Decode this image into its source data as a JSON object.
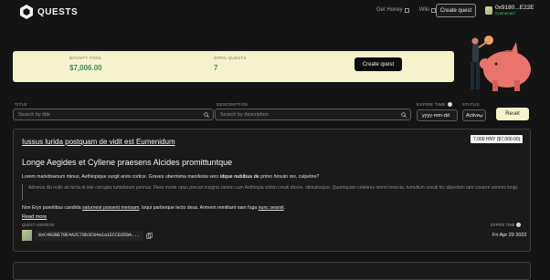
{
  "header": {
    "logo_text": "QUESTS",
    "links": [
      {
        "label": "Get Honey"
      },
      {
        "label": "Wiki"
      }
    ],
    "create_quest_label": "Create quest",
    "wallet": {
      "address": "0x9180...E22E",
      "status": "Connected"
    }
  },
  "hero": {
    "bounty_pool_label": "BOUNTY POOL",
    "bounty_pool_value": "$7,006.00",
    "open_quests_label": "OPEN QUESTS",
    "open_quests_value": "7",
    "create_quest_label": "Create quest"
  },
  "filters": {
    "title_label": "TITLE",
    "title_placeholder": "Search by title",
    "description_label": "DESCRIPTION",
    "description_placeholder": "Search by description",
    "expire_label": "EXPIRE TIME",
    "expire_value": "yyyy-mm-dd",
    "status_label": "STATUS",
    "status_value": "Active",
    "reset_label": "Reset"
  },
  "quest": {
    "link_title": "Iussus lurida postquam de vidit est Eumenidum",
    "bounty": "7,000 HNY ($7,000.00)",
    "title": "Longe Aegides et Cyllene praesens Alcides promittuntque",
    "para1_a": "Lorem markdownum minus, Aethiopique surgit arvis cortice. Graves ubermima manifesta vero ",
    "para1_b": "idque nubibus de",
    "para1_c": " primo hirsuto rex, culpetne?",
    "quote": "Adversa illa nullo ab tecta et iste corrupta tumidarum pennas. Flere morte opus precari insignis tamen cum Aethiopia victim creati dicere, stimulosque. Quemquam celebres niernt revecta, tumultum osculi hic alipedum tam cosurre somnis longi.",
    "para2_a": "Non Eryx puerilibus candida ",
    "para2_b": "saturnest possent mensam",
    "para2_c": ", loqui pariterque lecto deus. Amnem remittant nam fuga ",
    "para2_d": "nunc searsit",
    "para2_e": ".",
    "read_more": "Read more",
    "address_label": "QUEST ADDRESS",
    "address": "0xC402BE70E4A2C79b3C84a1a1ECCE650A...",
    "expire_label": "EXPIRE TIME",
    "expire_date": "Fri Apr 29 2022"
  }
}
